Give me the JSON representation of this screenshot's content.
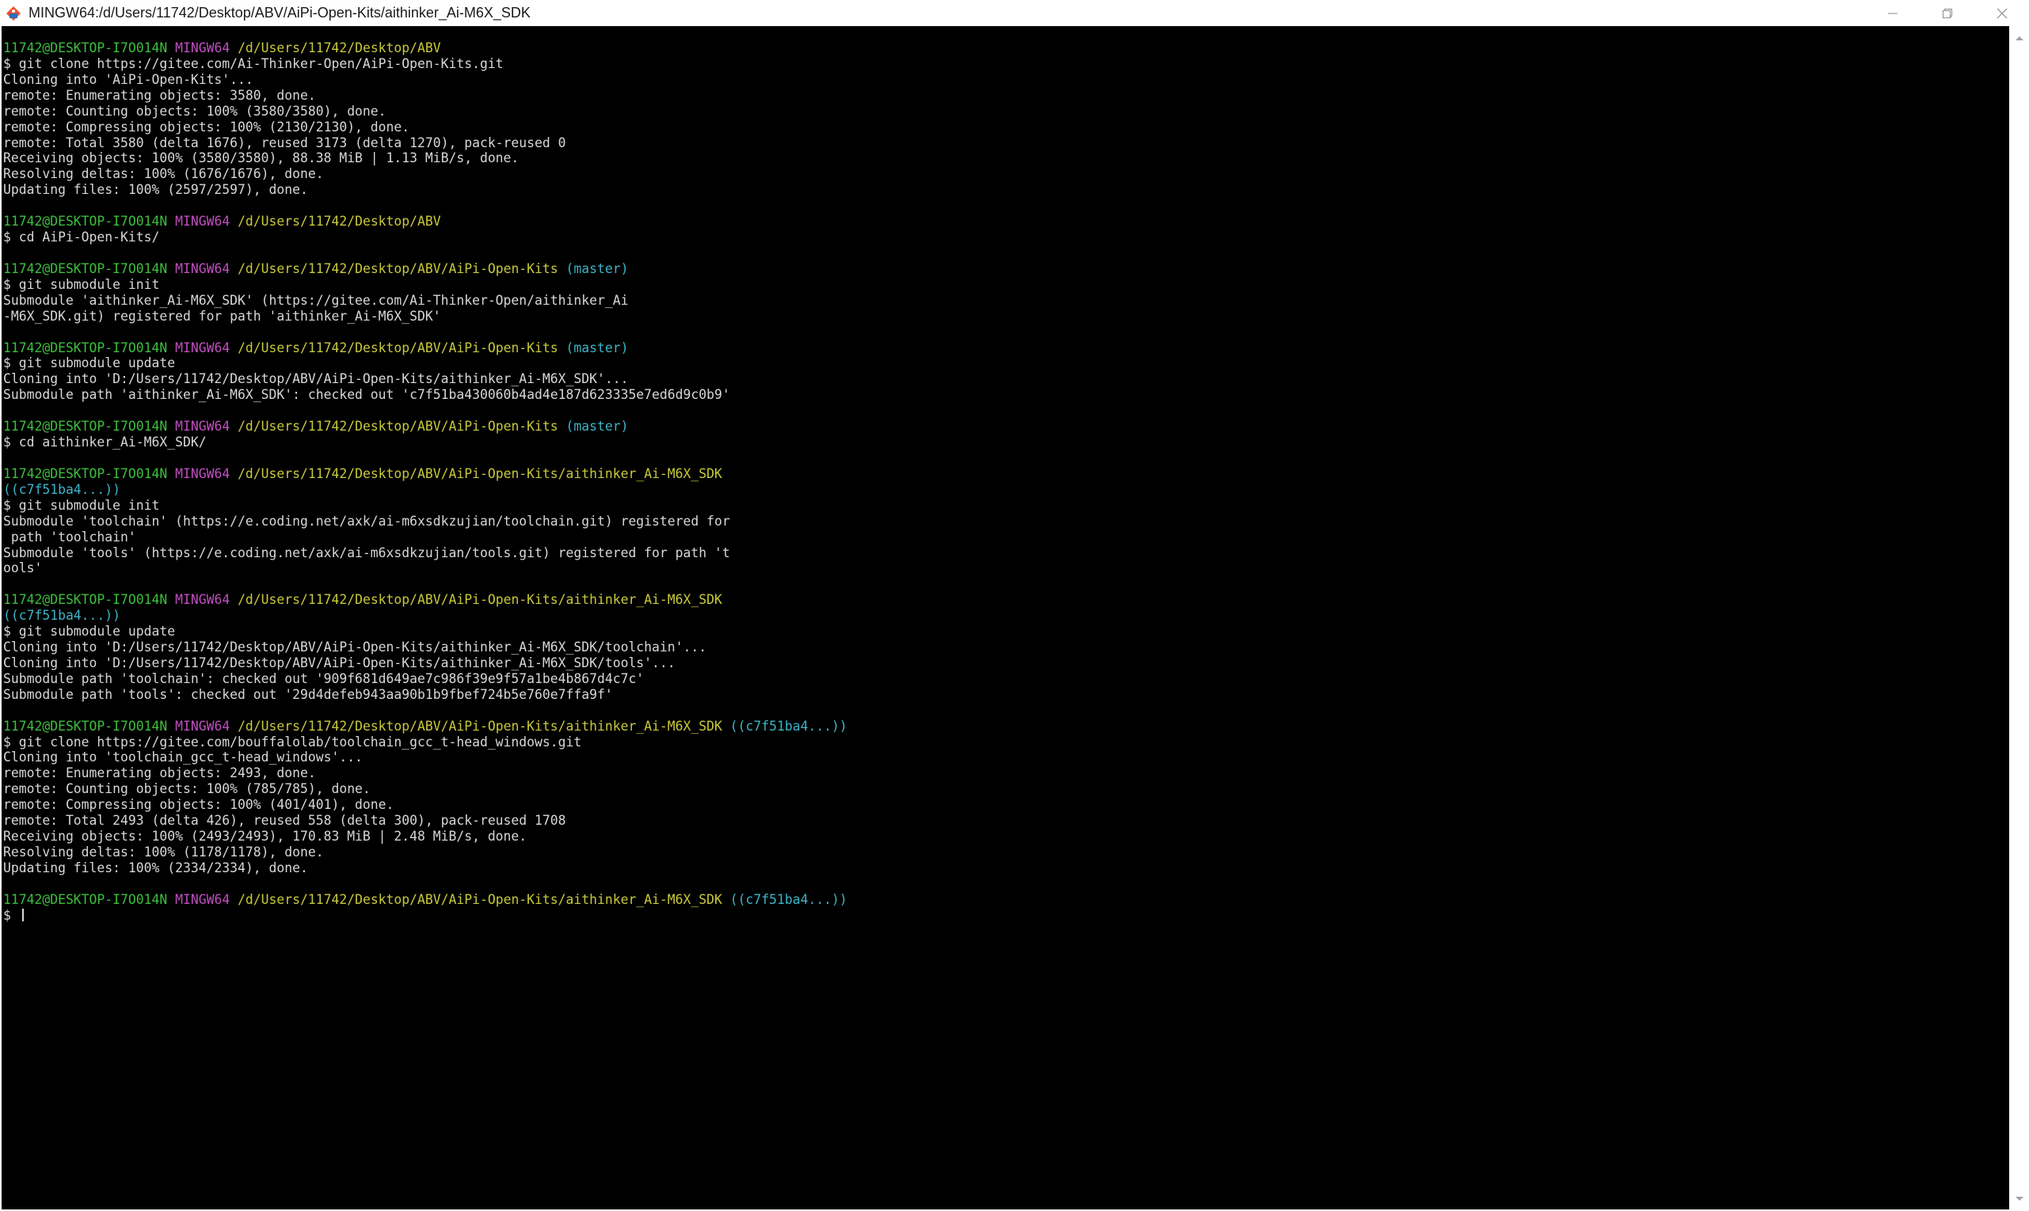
{
  "window": {
    "title": "MINGW64:/d/Users/11742/Desktop/ABV/AiPi-Open-Kits/aithinker_Ai-M6X_SDK",
    "icon": "git-bash-icon",
    "controls": [
      "minimize-icon",
      "maximize-icon",
      "close-icon"
    ]
  },
  "colors": {
    "user": "#3cbf3c",
    "host": "#bf4fbf",
    "path": "#c8c83c",
    "branch": "#3cb4c8",
    "text": "#d7d7d7",
    "background": "#000000"
  },
  "terminal": {
    "lines": [
      {
        "type": "prompt",
        "user": "11742@DESKTOP-I7O014N",
        "host": "MINGW64",
        "path": "/d/Users/11742/Desktop/ABV",
        "branch": ""
      },
      {
        "type": "text",
        "text": "$ git clone https://gitee.com/Ai-Thinker-Open/AiPi-Open-Kits.git"
      },
      {
        "type": "text",
        "text": "Cloning into 'AiPi-Open-Kits'..."
      },
      {
        "type": "text",
        "text": "remote: Enumerating objects: 3580, done."
      },
      {
        "type": "text",
        "text": "remote: Counting objects: 100% (3580/3580), done."
      },
      {
        "type": "text",
        "text": "remote: Compressing objects: 100% (2130/2130), done."
      },
      {
        "type": "text",
        "text": "remote: Total 3580 (delta 1676), reused 3173 (delta 1270), pack-reused 0"
      },
      {
        "type": "text",
        "text": "Receiving objects: 100% (3580/3580), 88.38 MiB | 1.13 MiB/s, done."
      },
      {
        "type": "text",
        "text": "Resolving deltas: 100% (1676/1676), done."
      },
      {
        "type": "text",
        "text": "Updating files: 100% (2597/2597), done."
      },
      {
        "type": "text",
        "text": ""
      },
      {
        "type": "prompt",
        "user": "11742@DESKTOP-I7O014N",
        "host": "MINGW64",
        "path": "/d/Users/11742/Desktop/ABV",
        "branch": ""
      },
      {
        "type": "text",
        "text": "$ cd AiPi-Open-Kits/"
      },
      {
        "type": "text",
        "text": ""
      },
      {
        "type": "prompt",
        "user": "11742@DESKTOP-I7O014N",
        "host": "MINGW64",
        "path": "/d/Users/11742/Desktop/ABV/AiPi-Open-Kits",
        "branch": "(master)"
      },
      {
        "type": "text",
        "text": "$ git submodule init"
      },
      {
        "type": "text",
        "text": "Submodule 'aithinker_Ai-M6X_SDK' (https://gitee.com/Ai-Thinker-Open/aithinker_Ai"
      },
      {
        "type": "text",
        "text": "-M6X_SDK.git) registered for path 'aithinker_Ai-M6X_SDK'"
      },
      {
        "type": "text",
        "text": ""
      },
      {
        "type": "prompt",
        "user": "11742@DESKTOP-I7O014N",
        "host": "MINGW64",
        "path": "/d/Users/11742/Desktop/ABV/AiPi-Open-Kits",
        "branch": "(master)"
      },
      {
        "type": "text",
        "text": "$ git submodule update"
      },
      {
        "type": "text",
        "text": "Cloning into 'D:/Users/11742/Desktop/ABV/AiPi-Open-Kits/aithinker_Ai-M6X_SDK'..."
      },
      {
        "type": "text",
        "text": "Submodule path 'aithinker_Ai-M6X_SDK': checked out 'c7f51ba430060b4ad4e187d623335e7ed6d9c0b9'"
      },
      {
        "type": "text",
        "text": ""
      },
      {
        "type": "prompt",
        "user": "11742@DESKTOP-I7O014N",
        "host": "MINGW64",
        "path": "/d/Users/11742/Desktop/ABV/AiPi-Open-Kits",
        "branch": "(master)"
      },
      {
        "type": "text",
        "text": "$ cd aithinker_Ai-M6X_SDK/"
      },
      {
        "type": "text",
        "text": ""
      },
      {
        "type": "prompt",
        "user": "11742@DESKTOP-I7O014N",
        "host": "MINGW64",
        "path": "/d/Users/11742/Desktop/ABV/AiPi-Open-Kits/aithinker_Ai-M6X_SDK",
        "branch": ""
      },
      {
        "type": "branchline",
        "text": "((c7f51ba4...))"
      },
      {
        "type": "text",
        "text": "$ git submodule init"
      },
      {
        "type": "text",
        "text": "Submodule 'toolchain' (https://e.coding.net/axk/ai-m6xsdkzujian/toolchain.git) registered for"
      },
      {
        "type": "text",
        "text": " path 'toolchain'"
      },
      {
        "type": "text",
        "text": "Submodule 'tools' (https://e.coding.net/axk/ai-m6xsdkzujian/tools.git) registered for path 't"
      },
      {
        "type": "text",
        "text": "ools'"
      },
      {
        "type": "text",
        "text": ""
      },
      {
        "type": "prompt",
        "user": "11742@DESKTOP-I7O014N",
        "host": "MINGW64",
        "path": "/d/Users/11742/Desktop/ABV/AiPi-Open-Kits/aithinker_Ai-M6X_SDK",
        "branch": ""
      },
      {
        "type": "branchline",
        "text": "((c7f51ba4...))"
      },
      {
        "type": "text",
        "text": "$ git submodule update"
      },
      {
        "type": "text",
        "text": "Cloning into 'D:/Users/11742/Desktop/ABV/AiPi-Open-Kits/aithinker_Ai-M6X_SDK/toolchain'..."
      },
      {
        "type": "text",
        "text": "Cloning into 'D:/Users/11742/Desktop/ABV/AiPi-Open-Kits/aithinker_Ai-M6X_SDK/tools'..."
      },
      {
        "type": "text",
        "text": "Submodule path 'toolchain': checked out '909f681d649ae7c986f39e9f57a1be4b867d4c7c'"
      },
      {
        "type": "text",
        "text": "Submodule path 'tools': checked out '29d4defeb943aa90b1b9fbef724b5e760e7ffa9f'"
      },
      {
        "type": "text",
        "text": ""
      },
      {
        "type": "prompt",
        "user": "11742@DESKTOP-I7O014N",
        "host": "MINGW64",
        "path": "/d/Users/11742/Desktop/ABV/AiPi-Open-Kits/aithinker_Ai-M6X_SDK",
        "branch": "((c7f51ba4...))"
      },
      {
        "type": "text",
        "text": "$ git clone https://gitee.com/bouffalolab/toolchain_gcc_t-head_windows.git"
      },
      {
        "type": "text",
        "text": "Cloning into 'toolchain_gcc_t-head_windows'..."
      },
      {
        "type": "text",
        "text": "remote: Enumerating objects: 2493, done."
      },
      {
        "type": "text",
        "text": "remote: Counting objects: 100% (785/785), done."
      },
      {
        "type": "text",
        "text": "remote: Compressing objects: 100% (401/401), done."
      },
      {
        "type": "text",
        "text": "remote: Total 2493 (delta 426), reused 558 (delta 300), pack-reused 1708"
      },
      {
        "type": "text",
        "text": "Receiving objects: 100% (2493/2493), 170.83 MiB | 2.48 MiB/s, done."
      },
      {
        "type": "text",
        "text": "Resolving deltas: 100% (1178/1178), done."
      },
      {
        "type": "text",
        "text": "Updating files: 100% (2334/2334), done."
      },
      {
        "type": "text",
        "text": ""
      },
      {
        "type": "prompt",
        "user": "11742@DESKTOP-I7O014N",
        "host": "MINGW64",
        "path": "/d/Users/11742/Desktop/ABV/AiPi-Open-Kits/aithinker_Ai-M6X_SDK",
        "branch": "((c7f51ba4...))"
      },
      {
        "type": "input",
        "text": "$ "
      }
    ]
  }
}
